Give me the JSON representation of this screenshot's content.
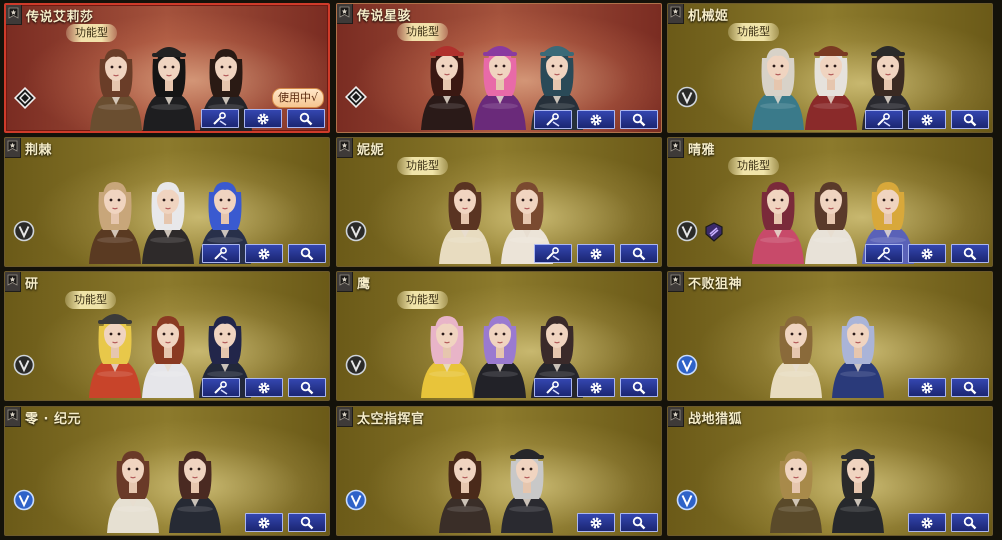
{
  "labels": {
    "type_badge": "功能型",
    "in_use": "使用中√"
  },
  "colors": {
    "gold_card": "#8c7a2c",
    "red_card": "#a4523c",
    "selected_border": "#cf3b2a",
    "button_fill": "#2a3a9a",
    "rank_silver": "#cfd4da",
    "rank_blue": "#2e62c8"
  },
  "icons": {
    "corner": "star-tag-icon",
    "button_1": "wrench-screwdriver-icon",
    "button_2": "gear-icon",
    "button_3": "magnifier-icon"
  },
  "cards": [
    {
      "title": "传说艾莉莎",
      "theme": "red",
      "selected": true,
      "badge": true,
      "in_use": true,
      "rank": "legend",
      "extra": false,
      "buttons": 3,
      "characters": [
        {
          "hair": "#6a3d28",
          "outfit": "#6a4e30",
          "hat": ""
        },
        {
          "hair": "#151515",
          "outfit": "#1e1e20",
          "hat": "#222"
        },
        {
          "hair": "#2a1a14",
          "outfit": "#242429",
          "hat": ""
        }
      ]
    },
    {
      "title": "传说星骇",
      "theme": "red",
      "selected": false,
      "badge": true,
      "in_use": false,
      "rank": "legend",
      "extra": false,
      "buttons": 3,
      "characters": [
        {
          "hair": "#3a1812",
          "outfit": "#2a1a18",
          "hat": "#b0302c"
        },
        {
          "hair": "#e86aa8",
          "outfit": "#6a2a7a",
          "hat": "#8a3aa0"
        },
        {
          "hair": "#2a4a58",
          "outfit": "#26303a",
          "hat": "#3a6a78"
        }
      ]
    },
    {
      "title": "机械姬",
      "theme": "gold",
      "selected": false,
      "badge": true,
      "in_use": false,
      "rank": "silver",
      "extra": false,
      "buttons": 3,
      "characters": [
        {
          "hair": "#d8d2c8",
          "outfit": "#3a7a8a",
          "hat": ""
        },
        {
          "hair": "#e6e2dc",
          "outfit": "#8a2a2a",
          "hat": "#7a3a22"
        },
        {
          "hair": "#3a2a22",
          "outfit": "#2a2a30",
          "hat": "#2a2a2a"
        }
      ]
    },
    {
      "title": "荆棘",
      "theme": "gold",
      "selected": false,
      "badge": false,
      "in_use": false,
      "rank": "silver",
      "extra": false,
      "buttons": 3,
      "characters": [
        {
          "hair": "#c8a67a",
          "outfit": "#5a3a22",
          "hat": ""
        },
        {
          "hair": "#e8e8ea",
          "outfit": "#2e2a2a",
          "hat": ""
        },
        {
          "hair": "#3a5ad0",
          "outfit": "#28304a",
          "hat": ""
        }
      ]
    },
    {
      "title": "妮妮",
      "theme": "gold",
      "selected": false,
      "badge": true,
      "in_use": false,
      "rank": "silver",
      "extra": false,
      "buttons": 3,
      "characters": [
        {
          "hair": "#5a3422",
          "outfit": "#e8dcc0",
          "hat": ""
        },
        {
          "hair": "#7a4a30",
          "outfit": "#ece4d8",
          "hat": ""
        }
      ]
    },
    {
      "title": "晴雅",
      "theme": "gold",
      "selected": false,
      "badge": true,
      "in_use": false,
      "rank": "silver",
      "extra": true,
      "buttons": 3,
      "characters": [
        {
          "hair": "#7a2a3a",
          "outfit": "#c84a6a",
          "hat": ""
        },
        {
          "hair": "#5a3a2a",
          "outfit": "#e8e2d8",
          "hat": ""
        },
        {
          "hair": "#d8a83a",
          "outfit": "#5a62b8",
          "hat": ""
        }
      ]
    },
    {
      "title": "研",
      "theme": "gold",
      "selected": false,
      "badge": true,
      "in_use": false,
      "rank": "silver",
      "extra": false,
      "buttons": 3,
      "characters": [
        {
          "hair": "#e8c84a",
          "outfit": "#c8442a",
          "hat": "#3a3a3a"
        },
        {
          "hair": "#8a3a22",
          "outfit": "#e6e6ea",
          "hat": ""
        },
        {
          "hair": "#22264a",
          "outfit": "#22283a",
          "hat": ""
        }
      ]
    },
    {
      "title": "鹰",
      "theme": "gold",
      "selected": false,
      "badge": true,
      "in_use": false,
      "rank": "silver",
      "extra": false,
      "buttons": 3,
      "characters": [
        {
          "hair": "#e8b4c8",
          "outfit": "#e8c43a",
          "hat": ""
        },
        {
          "hair": "#9a7ad0",
          "outfit": "#222228",
          "hat": ""
        },
        {
          "hair": "#3a2a2a",
          "outfit": "#26262c",
          "hat": ""
        }
      ]
    },
    {
      "title": "不败狙神",
      "theme": "gold",
      "selected": false,
      "badge": false,
      "in_use": false,
      "rank": "blue",
      "extra": false,
      "buttons": 2,
      "characters": [
        {
          "hair": "#8a6a3a",
          "outfit": "#e8dcc0",
          "hat": ""
        },
        {
          "hair": "#aab4d8",
          "outfit": "#2a3a7a",
          "hat": ""
        }
      ]
    },
    {
      "title": "零 · 纪元",
      "theme": "gold",
      "selected": false,
      "badge": false,
      "in_use": false,
      "rank": "blue",
      "extra": false,
      "buttons": 2,
      "characters": [
        {
          "hair": "#6a3a28",
          "outfit": "#e6e0d2",
          "hat": ""
        },
        {
          "hair": "#4a2a22",
          "outfit": "#262a34",
          "hat": ""
        }
      ]
    },
    {
      "title": "太空指挥官",
      "theme": "gold",
      "selected": false,
      "badge": false,
      "in_use": false,
      "rank": "blue",
      "extra": false,
      "buttons": 2,
      "characters": [
        {
          "hair": "#4a2a1a",
          "outfit": "#3a2e28",
          "hat": ""
        },
        {
          "hair": "#c8c8c8",
          "outfit": "#2a2a30",
          "hat": "#26262a"
        }
      ]
    },
    {
      "title": "战地猎狐",
      "theme": "gold",
      "selected": false,
      "badge": false,
      "in_use": false,
      "rank": "blue",
      "extra": false,
      "buttons": 2,
      "characters": [
        {
          "hair": "#a88a4a",
          "outfit": "#5a4a2a",
          "hat": ""
        },
        {
          "hair": "#2a2a2a",
          "outfit": "#26282c",
          "hat": "#2a2c30"
        }
      ]
    }
  ]
}
